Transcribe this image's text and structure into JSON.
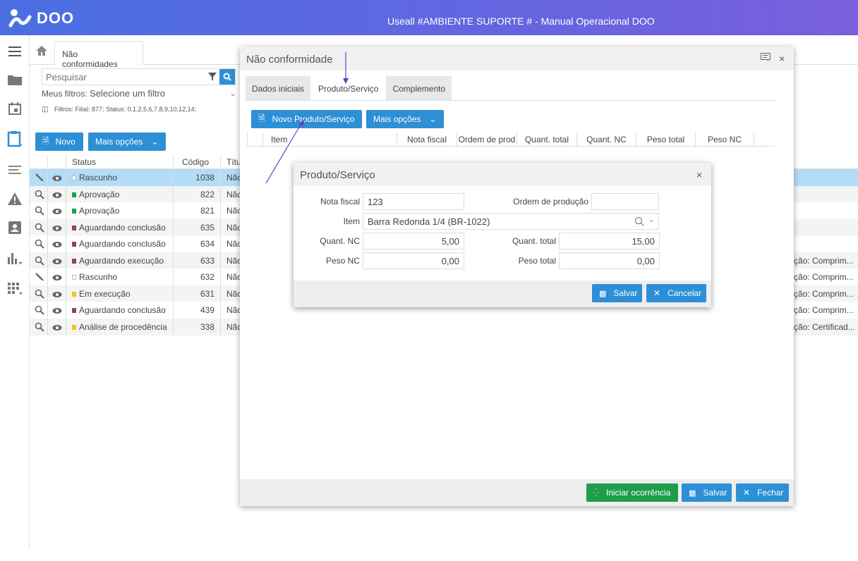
{
  "app": {
    "brand": "DOO",
    "title": "Useall #AMBIENTE SUPORTE # - Manual Operacional DOO"
  },
  "tabs": {
    "page_tab": "Não conformidades"
  },
  "search": {
    "placeholder": "Pesquisar"
  },
  "filters": {
    "label": "Meus filtros:",
    "value": "Selecione um filtro",
    "applied": "Filtros: Filial: 877; Status: 0,1,2,5,6,7,8,9,10,12,14;"
  },
  "toolbar": {
    "new_label": "Novo",
    "more_label": "Mais opções"
  },
  "grid": {
    "columns": [
      "Status",
      "Código",
      "Títu"
    ],
    "rows": [
      {
        "status": "Rascunho",
        "code": "1038",
        "title": "Nãc",
        "color": "#ffffff",
        "selected": true,
        "edit": true,
        "extra": ""
      },
      {
        "status": "Aprovação",
        "code": "822",
        "title": "Nãc",
        "color": "#1f9e4a",
        "selected": false,
        "edit": false,
        "extra": ""
      },
      {
        "status": "Aprovação",
        "code": "821",
        "title": "Nãc",
        "color": "#1f9e4a",
        "selected": false,
        "edit": false,
        "extra": ""
      },
      {
        "status": "Aguardando conclusão",
        "code": "635",
        "title": "Nãc",
        "color": "#8b4a44",
        "selected": false,
        "edit": false,
        "extra": ""
      },
      {
        "status": "Aguardando conclusão",
        "code": "634",
        "title": "Nãc",
        "color": "#8b4a44",
        "selected": false,
        "edit": false,
        "extra": ""
      },
      {
        "status": "Aguardando execução",
        "code": "633",
        "title": "Nãc",
        "color": "#8b4a44",
        "selected": false,
        "edit": false,
        "extra": "ção: Comprim..."
      },
      {
        "status": "Rascunho",
        "code": "632",
        "title": "Nãc",
        "color": "#ffffff",
        "selected": false,
        "edit": true,
        "extra": "ção: Comprim..."
      },
      {
        "status": "Em execução",
        "code": "631",
        "title": "Nãc",
        "color": "#f2c12e",
        "selected": false,
        "edit": false,
        "extra": "ção: Comprim..."
      },
      {
        "status": "Aguardando conclusão",
        "code": "439",
        "title": "Nãc",
        "color": "#8b4a44",
        "selected": false,
        "edit": false,
        "extra": "ção: Comprim..."
      },
      {
        "status": "Análise de procedência",
        "code": "338",
        "title": "Nãc",
        "color": "#f2c12e",
        "selected": false,
        "edit": false,
        "extra": "ção: Certificad..."
      }
    ]
  },
  "modal": {
    "title": "Não conformidade",
    "tabs": [
      "Dados iniciais",
      "Produto/Serviço",
      "Complemento"
    ],
    "new_product_label": "Novo Produto/Serviço",
    "more_label": "Mais opções",
    "columns": [
      "Item",
      "Nota fiscal",
      "Ordem de prod",
      "Quant. total",
      "Quant. NC",
      "Peso total",
      "Peso NC"
    ],
    "start_label": "Iniciar ocorrência",
    "save_label": "Salvar",
    "close_label": "Fechar"
  },
  "dialog": {
    "title": "Produto/Serviço",
    "nota_fiscal_label": "Nota fiscal",
    "nota_fiscal_value": "123",
    "ordem_label": "Ordem de produção",
    "ordem_value": "",
    "item_label": "Item",
    "item_value": "Barra Redonda 1/4 (BR-1022)",
    "quant_nc_label": "Quant. NC",
    "quant_nc_value": "5,00",
    "quant_total_label": "Quant. total",
    "quant_total_value": "15,00",
    "peso_nc_label": "Peso NC",
    "peso_nc_value": "0,00",
    "peso_total_label": "Peso total",
    "peso_total_value": "0,00",
    "save_label": "Salvar",
    "cancel_label": "Cancelar"
  },
  "colors": {
    "accent": "#2d8fd5",
    "success": "#1f9e4a",
    "selected_row": "#b3dcf7",
    "annotation": "#6a3fb5"
  }
}
